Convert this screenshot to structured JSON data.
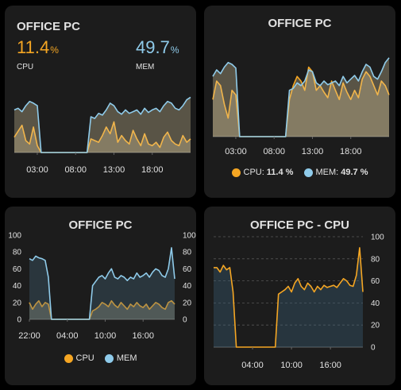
{
  "colors": {
    "cpu": "#f5a623",
    "mem": "#8fcbea",
    "background": "#000000",
    "card": "#1c1c1c"
  },
  "card1": {
    "title": "OFFICE PC",
    "cpu_value": "11.4",
    "cpu_unit": "%",
    "cpu_label": "CPU",
    "mem_value": "49.7",
    "mem_unit": "%",
    "mem_label": "MEM",
    "x_ticks": [
      "03:00",
      "08:00",
      "13:00",
      "18:00"
    ]
  },
  "card2": {
    "title": "OFFICE PC",
    "x_ticks": [
      "03:00",
      "08:00",
      "13:00",
      "18:00"
    ],
    "legend": [
      {
        "name": "CPU:",
        "value": "11.4 %"
      },
      {
        "name": "MEM:",
        "value": "49.7 %"
      }
    ]
  },
  "card3": {
    "title": "OFFICE PC",
    "y_ticks": [
      "100",
      "80",
      "60",
      "40",
      "20",
      "0"
    ],
    "x_ticks": [
      "22:00",
      "04:00",
      "10:00",
      "16:00"
    ],
    "legend": [
      {
        "name": "CPU"
      },
      {
        "name": "MEM"
      }
    ]
  },
  "card4": {
    "title": "OFFICE PC - CPU",
    "y_ticks": [
      "100",
      "80",
      "60",
      "40",
      "20",
      "0"
    ],
    "x_ticks": [
      "04:00",
      "10:00",
      "16:00"
    ]
  },
  "chart_data": [
    {
      "type": "area",
      "x": [
        0,
        0.5,
        1,
        1.5,
        2,
        2.5,
        3,
        3.5,
        4,
        4.5,
        5,
        5.5,
        6,
        6.5,
        7,
        7.5,
        8,
        8.5,
        9,
        9.5,
        10,
        10.5,
        11,
        11.5,
        12,
        12.5,
        13,
        13.5,
        14,
        14.5,
        15,
        15.5,
        16,
        16.5,
        17,
        17.5,
        18,
        18.5,
        19,
        19.5,
        20,
        20.5,
        21,
        21.5,
        22,
        22.5,
        23
      ],
      "series": [
        {
          "name": "CPU",
          "values": [
            18,
            25,
            32,
            14,
            10,
            30,
            8,
            0,
            0,
            0,
            0,
            0,
            0,
            0,
            0,
            0,
            0,
            0,
            0,
            0,
            16,
            14,
            12,
            20,
            30,
            22,
            36,
            12,
            20,
            14,
            10,
            26,
            16,
            8,
            22,
            10,
            8,
            12,
            6,
            18,
            24,
            14,
            10,
            8,
            20,
            12,
            16
          ]
        },
        {
          "name": "MEM",
          "values": [
            50,
            52,
            48,
            55,
            60,
            58,
            55,
            0,
            0,
            0,
            0,
            0,
            0,
            0,
            0,
            0,
            0,
            0,
            0,
            0,
            42,
            40,
            46,
            44,
            50,
            58,
            55,
            48,
            45,
            50,
            46,
            48,
            50,
            45,
            52,
            47,
            50,
            52,
            48,
            55,
            60,
            58,
            52,
            50,
            55,
            62,
            65
          ]
        }
      ]
    },
    {
      "type": "area",
      "x": [
        0,
        0.5,
        1,
        1.5,
        2,
        2.5,
        3,
        3.5,
        4,
        4.5,
        5,
        5.5,
        6,
        6.5,
        7,
        7.5,
        8,
        8.5,
        9,
        9.5,
        10,
        10.5,
        11,
        11.5,
        12,
        12.5,
        13,
        13.5,
        14,
        14.5,
        15,
        15.5,
        16,
        16.5,
        17,
        17.5,
        18,
        18.5,
        19,
        19.5,
        20,
        20.5,
        21,
        21.5,
        22,
        22.5,
        23
      ],
      "series": [
        {
          "name": "CPU",
          "values": [
            40,
            60,
            55,
            35,
            20,
            50,
            45,
            0,
            0,
            0,
            0,
            0,
            0,
            0,
            0,
            0,
            0,
            0,
            0,
            0,
            40,
            55,
            65,
            60,
            50,
            75,
            70,
            50,
            55,
            48,
            42,
            60,
            50,
            40,
            58,
            48,
            40,
            50,
            42,
            62,
            70,
            65,
            55,
            45,
            60,
            55,
            45
          ]
        },
        {
          "name": "MEM",
          "values": [
            65,
            72,
            68,
            75,
            80,
            78,
            74,
            0,
            0,
            0,
            0,
            0,
            0,
            0,
            0,
            0,
            0,
            0,
            0,
            0,
            50,
            52,
            58,
            55,
            60,
            72,
            70,
            58,
            55,
            60,
            56,
            58,
            60,
            55,
            65,
            58,
            62,
            66,
            60,
            70,
            78,
            75,
            65,
            62,
            70,
            80,
            85
          ]
        }
      ]
    },
    {
      "type": "area",
      "x": [
        0,
        0.5,
        1,
        1.5,
        2,
        2.5,
        3,
        3.5,
        4,
        4.5,
        5,
        5.5,
        6,
        6.5,
        7,
        7.5,
        8,
        8.5,
        9,
        9.5,
        10,
        10.5,
        11,
        11.5,
        12,
        12.5,
        13,
        13.5,
        14,
        14.5,
        15,
        15.5,
        16,
        16.5,
        17,
        17.5,
        18,
        18.5,
        19,
        19.5,
        20,
        20.5,
        21,
        21.5,
        22,
        22.5,
        23
      ],
      "ylim": [
        0,
        100
      ],
      "series": [
        {
          "name": "CPU",
          "values": [
            20,
            12,
            18,
            22,
            15,
            20,
            18,
            0,
            0,
            0,
            0,
            0,
            0,
            0,
            0,
            0,
            0,
            0,
            0,
            0,
            10,
            12,
            15,
            20,
            18,
            15,
            22,
            17,
            14,
            20,
            16,
            12,
            18,
            15,
            20,
            16,
            14,
            18,
            12,
            16,
            20,
            18,
            14,
            12,
            20,
            22,
            18
          ]
        },
        {
          "name": "MEM",
          "values": [
            72,
            70,
            75,
            73,
            72,
            70,
            50,
            0,
            0,
            0,
            0,
            0,
            0,
            0,
            0,
            0,
            0,
            0,
            0,
            0,
            40,
            45,
            50,
            52,
            48,
            55,
            60,
            50,
            48,
            52,
            50,
            46,
            50,
            48,
            55,
            50,
            52,
            55,
            50,
            56,
            60,
            58,
            52,
            50,
            60,
            85,
            48
          ]
        }
      ]
    },
    {
      "type": "area",
      "x": [
        0,
        0.5,
        1,
        1.5,
        2,
        2.5,
        3,
        3.5,
        4,
        4.5,
        5,
        5.5,
        6,
        6.5,
        7,
        7.5,
        8,
        8.5,
        9,
        9.5,
        10,
        10.5,
        11,
        11.5,
        12,
        12.5,
        13,
        13.5,
        14,
        14.5,
        15,
        15.5,
        16,
        16.5,
        17,
        17.5,
        18,
        18.5,
        19,
        19.5,
        20,
        20.5,
        21,
        21.5,
        22,
        22.5,
        23
      ],
      "ylim": [
        0,
        100
      ],
      "series": [
        {
          "name": "CPU",
          "values": [
            72,
            72,
            68,
            74,
            70,
            72,
            50,
            0,
            0,
            0,
            0,
            0,
            0,
            0,
            0,
            0,
            0,
            0,
            0,
            0,
            48,
            50,
            52,
            55,
            50,
            58,
            62,
            55,
            52,
            58,
            55,
            50,
            55,
            52,
            56,
            54,
            55,
            56,
            54,
            58,
            62,
            60,
            56,
            55,
            65,
            90,
            50
          ]
        }
      ]
    }
  ]
}
